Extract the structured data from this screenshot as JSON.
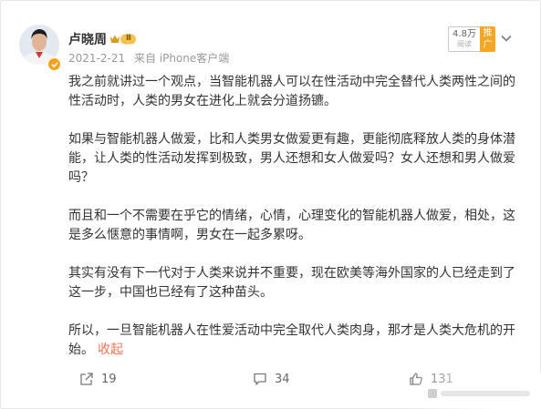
{
  "post": {
    "author": {
      "name": "卢晓周",
      "level_badge": "Ⅱ"
    },
    "date": "2021-2-21",
    "source": "来自 iPhone客户端",
    "reads": {
      "count": "4.8万",
      "label": "阅读"
    },
    "promote_label": "推广",
    "paragraphs": [
      "我之前就讲过一个观点，当智能机器人可以在性活动中完全替代人类两性之间的性活动时，人类的男女在进化上就会分道扬镳。",
      "如果与智能机器人做爱，比和人类男女做爱更有趣，更能彻底释放人类的身体潜能，让人类的性活动发挥到极致，男人还想和女人做爱吗？女人还想和男人做爱吗？",
      "而且和一个不需要在乎它的情绪，心情，心理变化的智能机器人做爱，相处，这是多么惬意的事情啊，男女在一起多累呀。",
      "其实有没有下一代对于人类来说并不重要，现在欧美等海外国家的人已经走到了这一步，中国也已经有了这种苗头。",
      "所以，一旦智能机器人在性爱活动中完全取代人类肉身，那才是人类大危机的开始。"
    ],
    "collapse_label": "收起",
    "actions": {
      "reposts": "19",
      "comments": "34",
      "likes": "131"
    }
  },
  "colors": {
    "accent_orange": "#eb7350",
    "verified_gold": "#f7a21b",
    "text_main": "#333333",
    "text_meta": "#999999"
  }
}
